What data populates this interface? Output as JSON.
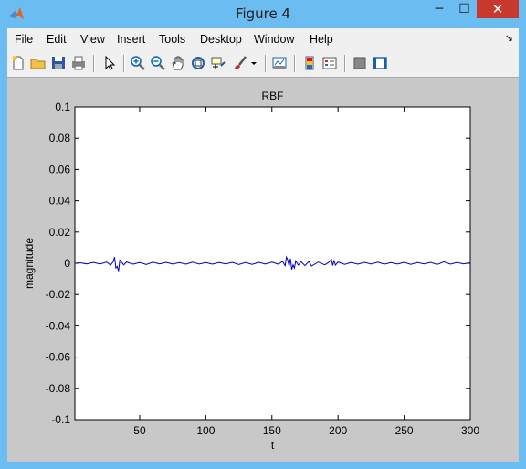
{
  "window": {
    "title": "Figure 4",
    "minimize": "─",
    "maximize": "☐",
    "close": "✕"
  },
  "menu": [
    "File",
    "Edit",
    "View",
    "Insert",
    "Tools",
    "Desktop",
    "Window",
    "Help"
  ],
  "toolbar_icons": [
    "new-figure-icon",
    "open-file-icon",
    "save-icon",
    "print-icon",
    "pointer-icon",
    "zoom-in-icon",
    "zoom-out-icon",
    "pan-hand-icon",
    "rotate-3d-icon",
    "data-cursor-icon",
    "brush-icon",
    "link-plot-icon",
    "colorbar-icon",
    "legend-icon",
    "hide-plot-tools-icon",
    "show-plot-tools-icon"
  ],
  "chart_data": {
    "type": "line",
    "title": "RBF",
    "xlabel": "t",
    "ylabel": "magnitude",
    "xlim": [
      1,
      300
    ],
    "ylim": [
      -0.1,
      0.1
    ],
    "xticks": [
      50,
      100,
      150,
      200,
      250,
      300
    ],
    "yticks": [
      0.1,
      0.08,
      0.06,
      0.04,
      0.02,
      0,
      -0.02,
      -0.04,
      -0.06,
      -0.08,
      -0.1
    ],
    "ytick_labels": [
      "0.1",
      "0.08",
      "0.06",
      "0.04",
      "0.02",
      "0",
      "-0.02",
      "-0.04",
      "-0.06",
      "-0.08",
      "-0.1"
    ],
    "grid": false,
    "line_color": "#0000b4",
    "series": [
      {
        "x": [
          1,
          5,
          10,
          15,
          20,
          25,
          28,
          30,
          31,
          32,
          33,
          34,
          35,
          38,
          40,
          45,
          50,
          55,
          60,
          65,
          70,
          75,
          80,
          85,
          90,
          95,
          100,
          105,
          110,
          115,
          120,
          125,
          130,
          135,
          140,
          145,
          150,
          155,
          158,
          160,
          161,
          162,
          163,
          164,
          165,
          166,
          167,
          168,
          170,
          172,
          175,
          178,
          180,
          185,
          190,
          193,
          195,
          196,
          197,
          198,
          200,
          205,
          210,
          215,
          220,
          225,
          230,
          235,
          240,
          245,
          250,
          255,
          260,
          265,
          270,
          275,
          280,
          285,
          290,
          295,
          300
        ],
        "y": [
          0,
          0.0003,
          -0.0004,
          0.0006,
          -0.0005,
          0.0008,
          -0.0012,
          0.001,
          0.004,
          -0.003,
          -0.002,
          -0.005,
          0.002,
          -0.001,
          0.0008,
          -0.0006,
          0.0005,
          -0.0008,
          0.0007,
          -0.0004,
          0.0006,
          -0.0005,
          0.0004,
          -0.0006,
          0.0007,
          -0.0005,
          0.0004,
          -0.0006,
          0.0005,
          -0.0004,
          0.0006,
          -0.0008,
          0.0005,
          -0.0007,
          0.0006,
          -0.0005,
          0.0007,
          -0.0006,
          0.0012,
          -0.0015,
          0.004,
          0.002,
          -0.002,
          0.003,
          -0.004,
          -0.001,
          -0.003,
          0.0015,
          -0.0012,
          0.001,
          -0.0015,
          0.0012,
          -0.0018,
          0.0008,
          -0.001,
          0.0006,
          0.0025,
          -0.0015,
          0.002,
          -0.0012,
          0.0008,
          -0.0007,
          0.0005,
          -0.0006,
          0.0006,
          -0.0005,
          0.0007,
          -0.0006,
          0.0004,
          -0.0005,
          0.0006,
          -0.0007,
          0.0005,
          -0.0004,
          0.0006,
          -0.0008,
          0.0009,
          -0.0006,
          0.0005,
          -0.0004,
          0.0003
        ]
      }
    ]
  }
}
